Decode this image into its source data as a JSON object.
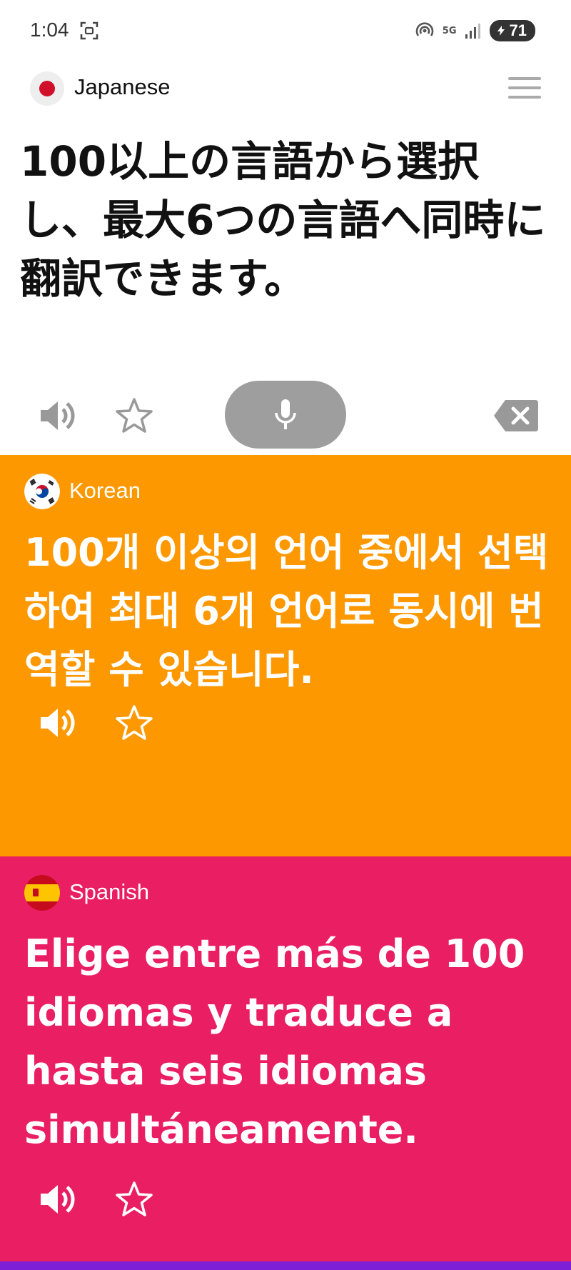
{
  "status_bar": {
    "time": "1:04",
    "network": "5G",
    "battery": "71"
  },
  "header": {
    "language": "Japanese"
  },
  "source": {
    "text": "100以上の言語から選択し、最大6つの言語へ同時に翻訳できます。"
  },
  "translations": [
    {
      "language": "Korean",
      "text": "100개 이상의 언어 중에서 선택하여 최대 6개 언어로 동시에 번역할 수 있습니다."
    },
    {
      "language": "Spanish",
      "text": "Elige entre más de 100 idiomas y traduce a hasta seis idiomas simultáneamente."
    }
  ],
  "icons": {
    "speaker": "speaker-icon",
    "favorite": "star-outline-icon",
    "mic": "microphone-icon",
    "clear": "backspace-icon",
    "menu": "hamburger-menu-icon"
  },
  "colors": {
    "korean_panel": "#fd9800",
    "spanish_panel": "#ea1e63",
    "mic_button": "#9e9e9e",
    "bottom_accent": "#7e1fd8"
  }
}
